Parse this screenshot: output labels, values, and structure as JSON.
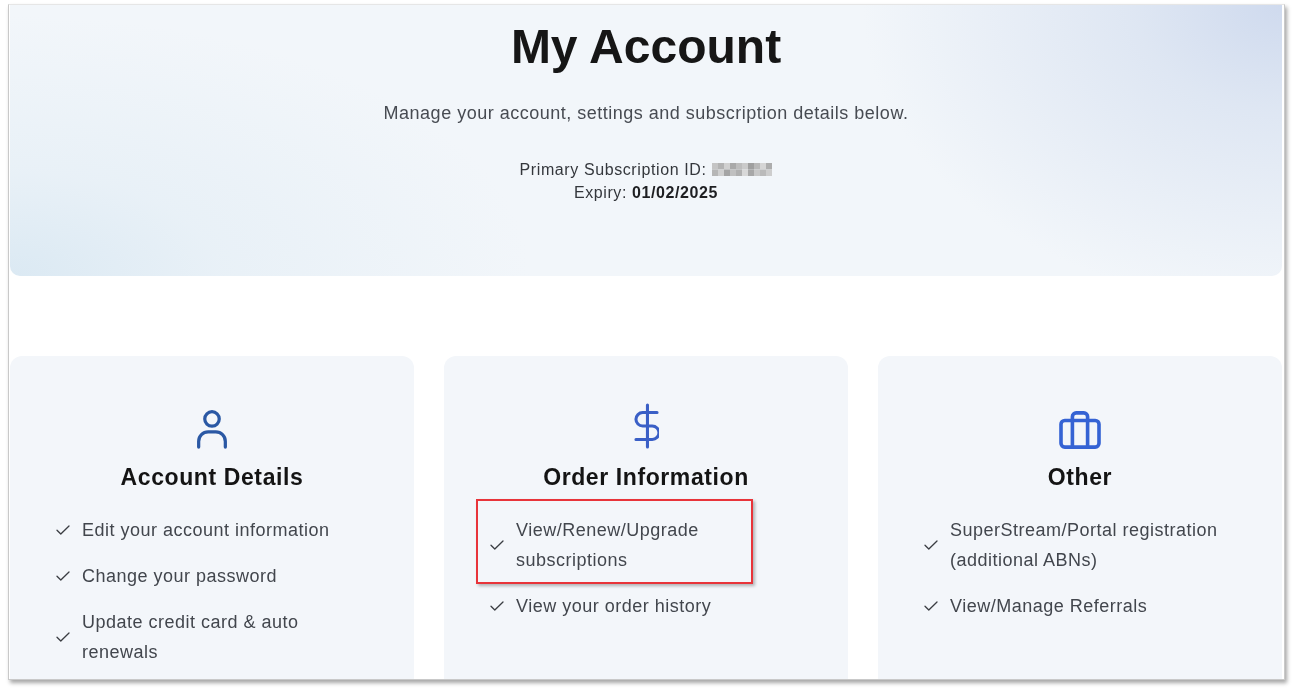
{
  "header": {
    "title": "My Account",
    "subtitle": "Manage your account, settings and subscription details below.",
    "subscription_id": {
      "label": "Primary Subscription ID:",
      "redacted": true
    },
    "expiry": "Expiry: **01/02/2025**"
  },
  "cards": [
    {
      "title": "Account Details",
      "items": [
        {
          "text": "Edit your account information",
          "highlighted": false
        },
        {
          "text": "Change your password",
          "highlighted": false
        },
        {
          "text": "Update credit card & auto renewals",
          "highlighted": false
        }
      ]
    },
    {
      "title": "Order Information",
      "items": [
        {
          "text": "View/Renew/Upgrade subscriptions",
          "highlighted": true
        },
        {
          "text": "View your order history",
          "highlighted": false
        }
      ]
    },
    {
      "title": "Other",
      "items": [
        {
          "text": "SuperStream/Portal registration (additional ABNs)",
          "highlighted": false
        },
        {
          "text": "View/Manage Referrals",
          "highlighted": false
        }
      ]
    }
  ]
}
